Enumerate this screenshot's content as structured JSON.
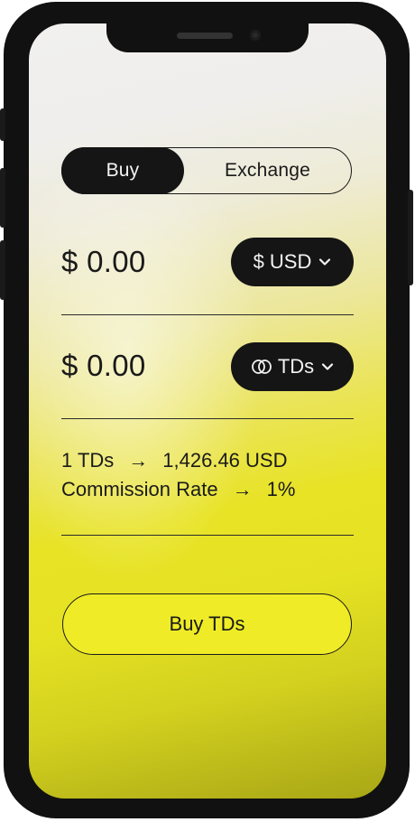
{
  "toggle": {
    "buy_label": "Buy",
    "exchange_label": "Exchange",
    "selected": "Buy"
  },
  "pay": {
    "amount": "$ 0.00",
    "currency_symbol": "$",
    "currency_label": "USD"
  },
  "receive": {
    "amount": "$ 0.00",
    "currency_label": "TDs"
  },
  "rate": {
    "left": "1 TDs",
    "arrow": "→",
    "right": "1,426.46 USD"
  },
  "commission": {
    "left": "Commission Rate",
    "arrow": "→",
    "right": "1%"
  },
  "action": {
    "buy_label": "Buy TDs"
  },
  "icons": {
    "dropdown": "chevron-down-icon",
    "td_currency": "td-coin-icon"
  },
  "colors": {
    "accent_yellow": "#efec27",
    "dark": "#151515",
    "text": "#1a1a1a"
  }
}
